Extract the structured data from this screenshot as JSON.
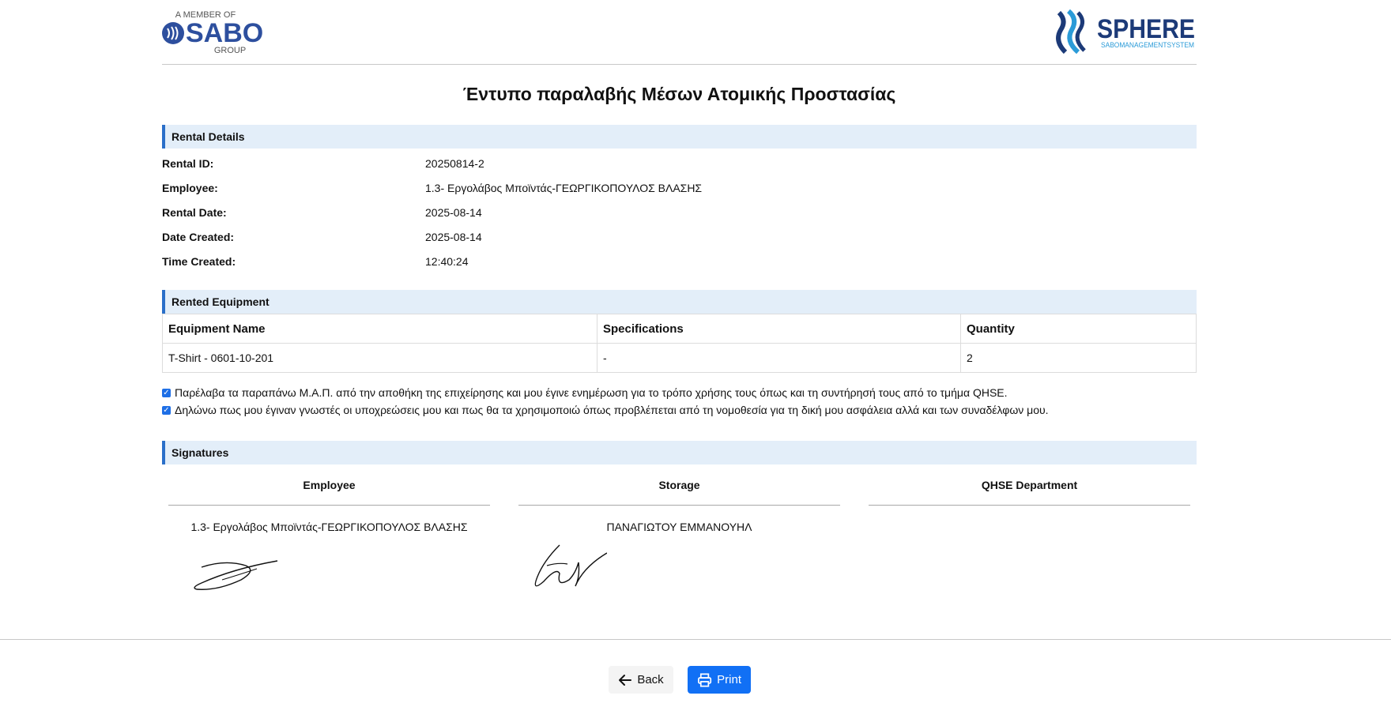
{
  "header": {
    "sabo_tagline": "A MEMBER OF",
    "sabo_name": "SABO",
    "sabo_group": "GROUP",
    "sphere_name": "SPHERE",
    "sphere_sub_a": "SABO",
    "sphere_sub_b": "MANAGEMENT",
    "sphere_sub_c": "SYSTEM",
    "colors": {
      "sabo_blue": "#2d4f9e",
      "sphere_navy": "#1c3a78",
      "sphere_light": "#2b9bd8"
    }
  },
  "title": "Έντυπο παραλαβής Μέσων Ατομικής Προστασίας",
  "rental_details": {
    "heading": "Rental Details",
    "rows": [
      {
        "label": "Rental ID:",
        "value": "20250814-2"
      },
      {
        "label": "Employee:",
        "value": "1.3- Εργολάβος Μποϊντάς-ΓΕΩΡΓΙΚΟΠΟΥΛΟΣ ΒΛΑΣΗΣ"
      },
      {
        "label": "Rental Date:",
        "value": "2025-08-14"
      },
      {
        "label": "Date Created:",
        "value": "2025-08-14"
      },
      {
        "label": "Time Created:",
        "value": "12:40:24"
      }
    ]
  },
  "equipment": {
    "heading": "Rented Equipment",
    "columns": [
      "Equipment Name",
      "Specifications",
      "Quantity"
    ],
    "rows": [
      [
        "T-Shirt - 0601-10-201",
        "-",
        "2"
      ]
    ]
  },
  "declarations": [
    {
      "checked": true,
      "text": "Παρέλαβα τα παραπάνω Μ.Α.Π. από την αποθήκη της επιχείρησης και μου έγινε ενημέρωση για το τρόπο χρήσης τους όπως και τη συντήρησή τους από το τμήμα QHSE."
    },
    {
      "checked": true,
      "text": "Δηλώνω πως μου έγιναν γνωστές οι υποχρεώσεις μου και πως θα τα χρησιμοποιώ όπως προβλέπεται από τη νομοθεσία για τη δική μου ασφάλεια αλλά και των συναδέλφων μου."
    }
  ],
  "signatures": {
    "heading": "Signatures",
    "items": [
      {
        "role": "Employee",
        "name": "1.3- Εργολάβος Μποϊντάς-ΓΕΩΡΓΙΚΟΠΟΥΛΟΣ ΒΛΑΣΗΣ",
        "signed": true
      },
      {
        "role": "Storage",
        "name": "ΠΑΝΑΓΙΩΤΟΥ ΕΜΜΑΝΟΥΗΛ",
        "signed": true
      },
      {
        "role": "QHSE Department",
        "name": "",
        "signed": false
      }
    ]
  },
  "actions": {
    "back_label": "Back",
    "print_label": "Print",
    "print_color": "#1170f5"
  }
}
